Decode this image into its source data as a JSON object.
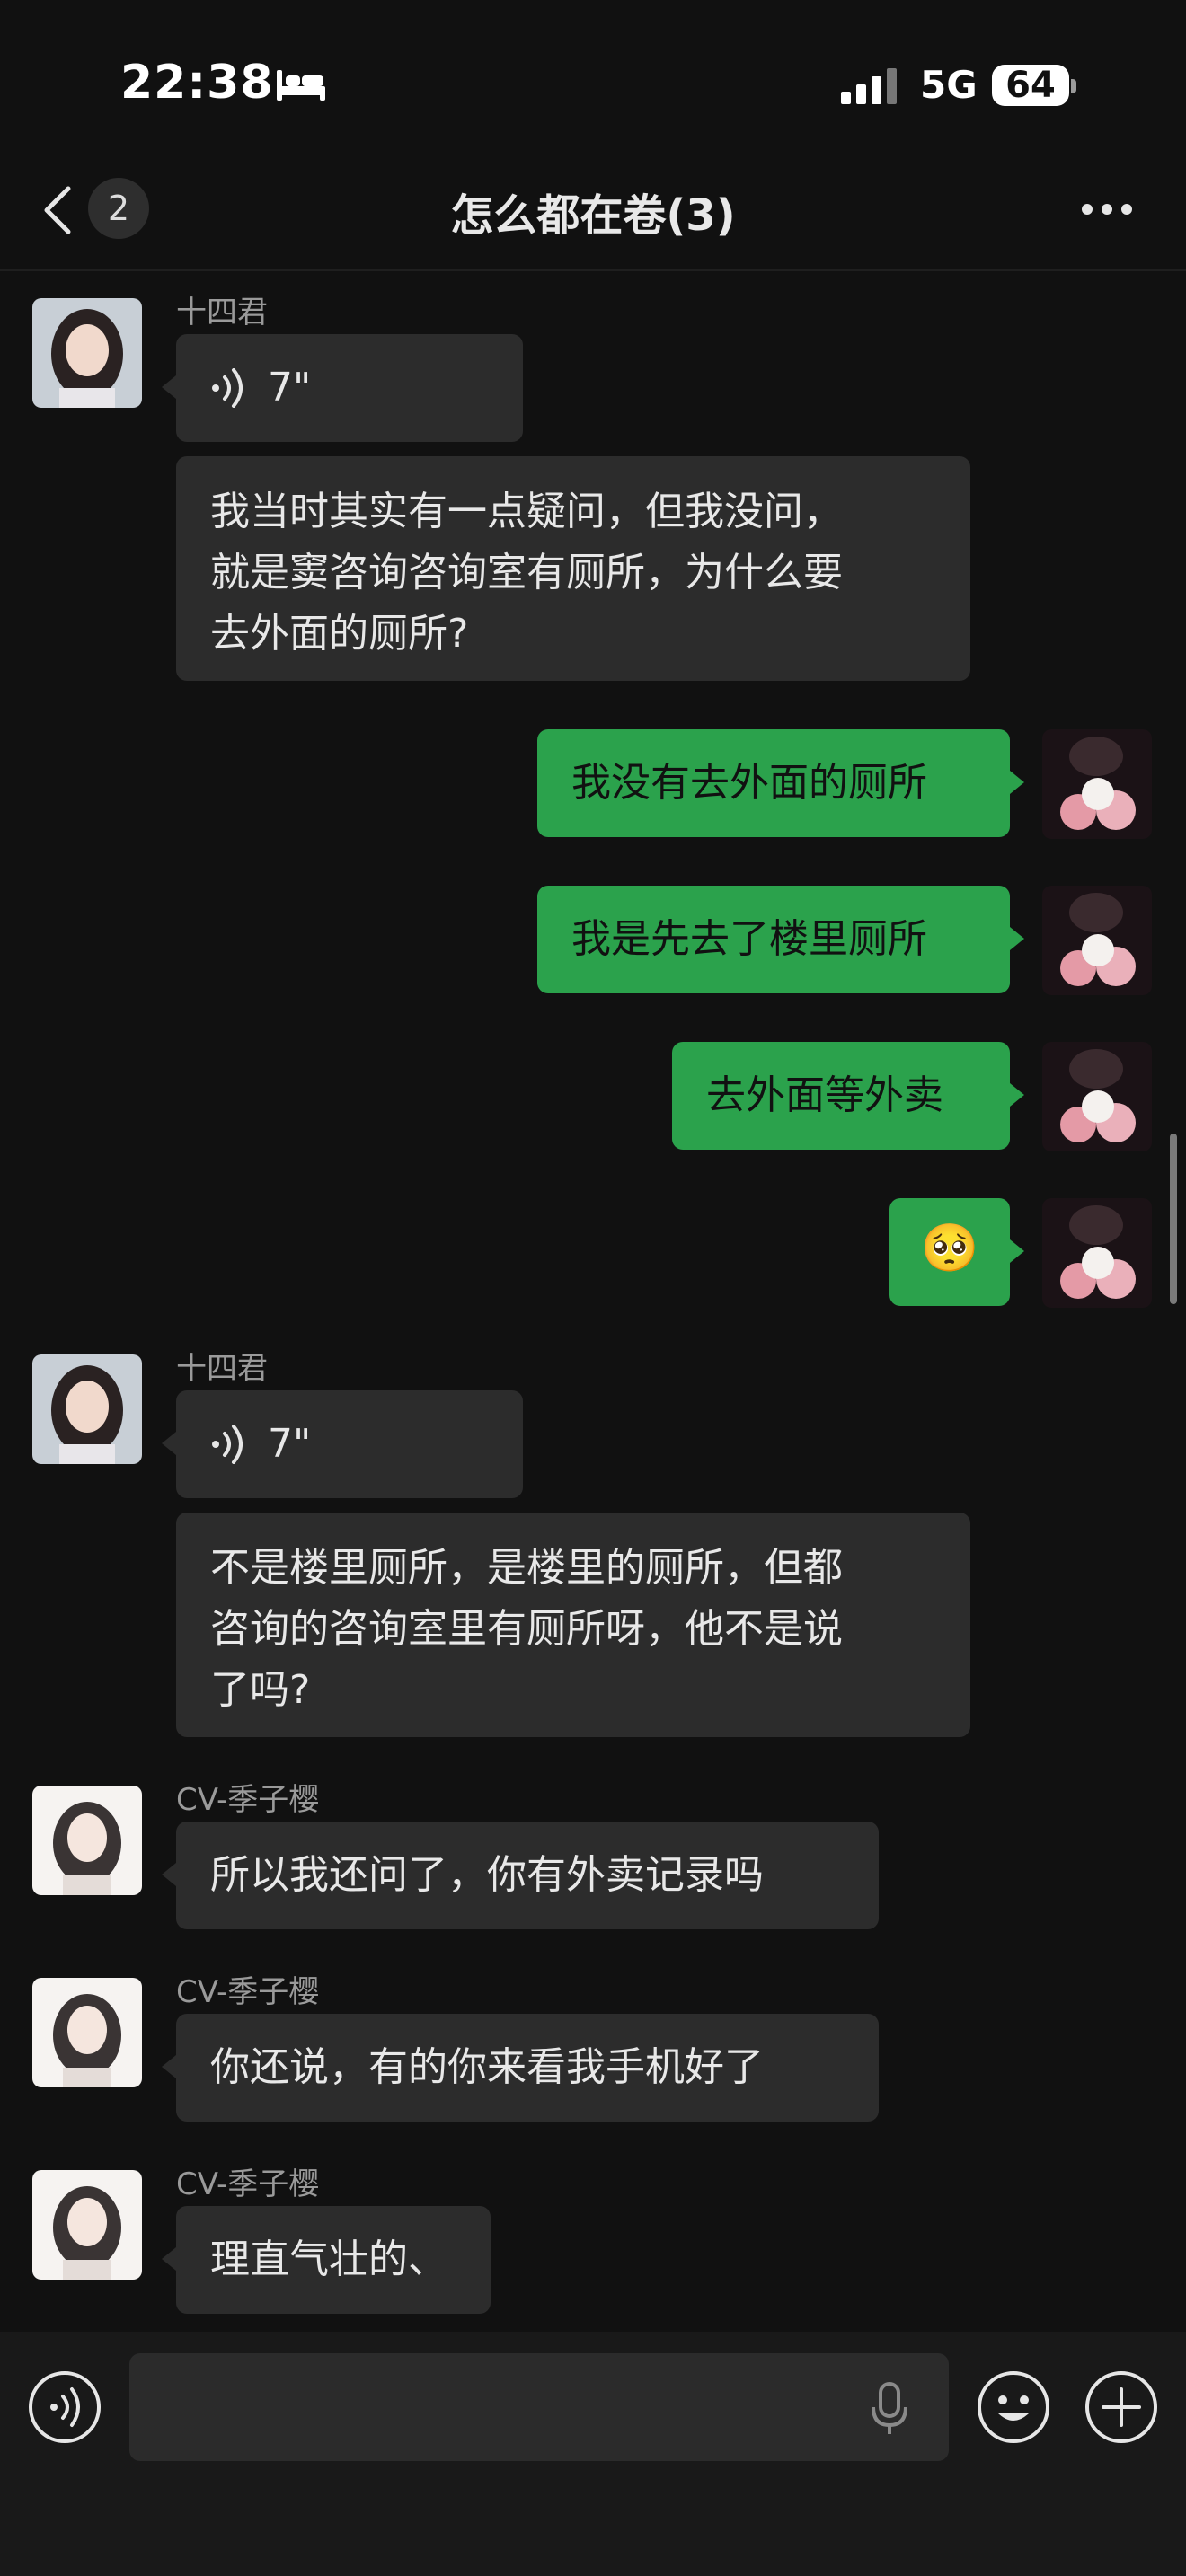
{
  "status_bar": {
    "time": "22:38",
    "network": "5G",
    "battery": "64"
  },
  "header": {
    "back_count": "2",
    "title": "怎么都在卷(3)"
  },
  "messages": [
    {
      "sender": "十四君",
      "voice_duration": "7\""
    },
    {
      "text_lines": [
        "我当时其实有一点疑问，但我没问，",
        "就是窦咨询咨询室有厕所，为什么要",
        "去外面的厕所?"
      ]
    },
    {
      "text": "我没有去外面的厕所"
    },
    {
      "text": "我是先去了楼里厕所"
    },
    {
      "text": "去外面等外卖"
    },
    {
      "emoji": "🥺"
    },
    {
      "sender": "十四君",
      "voice_duration": "7\""
    },
    {
      "text_lines": [
        "不是楼里厕所，是楼里的厕所，但都",
        "咨询的咨询室里有厕所呀，他不是说",
        "了吗?"
      ]
    },
    {
      "sender": "CV-季子樱",
      "text": "所以我还问了，你有外卖记录吗"
    },
    {
      "sender": "CV-季子樱",
      "text": "你还说，有的你来看我手机好了"
    },
    {
      "sender": "CV-季子樱",
      "text": "理直气壮的、"
    }
  ],
  "icons": {
    "back": "chevron-left-icon",
    "more": "more-dots-icon",
    "voice_toggle": "voice-icon",
    "mic": "microphone-icon",
    "emoji": "emoji-icon",
    "add": "plus-icon"
  },
  "colors": {
    "outgoing_bubble": "#2ba24c",
    "incoming_bubble": "#2c2c2c",
    "background": "#111111"
  }
}
